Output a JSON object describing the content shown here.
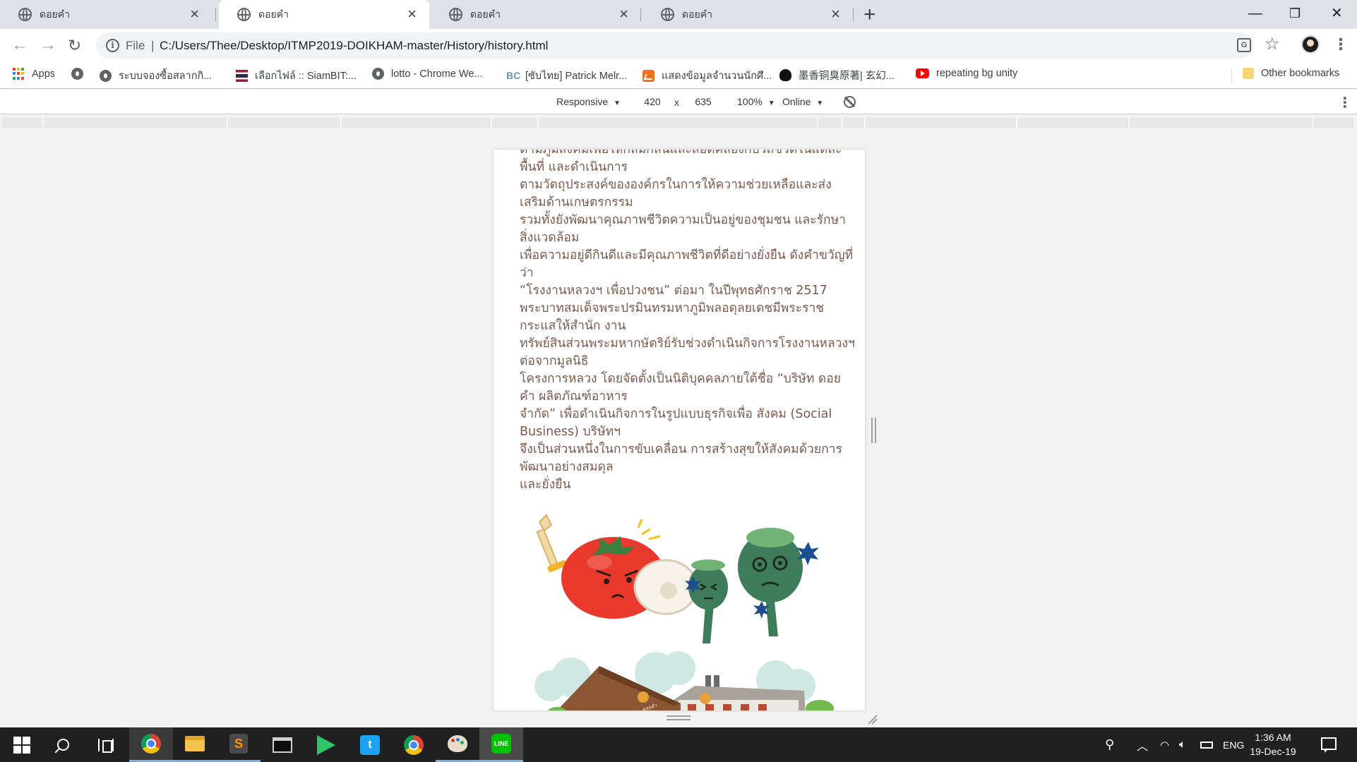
{
  "browser": {
    "tabs": [
      {
        "title": "ดอยคำ",
        "active": false
      },
      {
        "title": "ดอยคำ",
        "active": true
      },
      {
        "title": "ดอยคำ",
        "active": false
      },
      {
        "title": "ดอยคำ",
        "active": false
      }
    ],
    "new_tab_glyph": "+",
    "window_controls": {
      "minimize": "—",
      "restore": "❐",
      "close": "✕"
    },
    "address": {
      "scheme_label": "File",
      "separator": "|",
      "url": "C:/Users/Thee/Desktop/ITMP2019-DOIKHAM-master/History/history.html"
    },
    "icons": [
      "back-arrow-icon",
      "forward-arrow-icon",
      "reload-icon",
      "info-icon",
      "translate-icon",
      "star-icon",
      "profile-avatar",
      "more-vert-icon"
    ]
  },
  "bookmarks": {
    "items": [
      {
        "label": "Apps",
        "icon": "apps-grid-icon"
      },
      {
        "label": "",
        "icon": "globe-icon"
      },
      {
        "label": "ระบบจองซื้อสลากกิ...",
        "icon": "globe-icon"
      },
      {
        "label": "เลือกไฟล์ :: SiamBIT:...",
        "icon": "thai-flag-icon"
      },
      {
        "label": "lotto - Chrome We...",
        "icon": "globe-icon"
      },
      {
        "label": "[ซับไทย] Patrick Melr...",
        "icon": "bc-icon"
      },
      {
        "label": "แสดงข้อมูลจำนวนนักศึ...",
        "icon": "chart-icon"
      },
      {
        "label": "墨香铜臭原著| 玄幻...",
        "icon": "cat-icon"
      },
      {
        "label": "repeating bg unity",
        "icon": "youtube-icon"
      }
    ],
    "other": {
      "label": "Other bookmarks",
      "icon": "folder-icon"
    }
  },
  "device_toolbar": {
    "device": "Responsive",
    "width": "420",
    "times": "x",
    "height": "635",
    "zoom": "100%",
    "throttle": "Online",
    "caret": "▼"
  },
  "page": {
    "paragraph_lines": [
      "ตามภูมิสังคมเพื่อให้กลมกลืนและสอดคล้องกับวิถีชีวิตในแต่ละพื้นที่ และดำเนินการ",
      "ตามวัตถุประสงค์ขององค์กรในการให้ความช่วยเหลือและส่งเสริมด้านเกษตรกรรม",
      "รวมทั้งยังพัฒนาคุณภาพชีวิตความเป็นอยู่ของชุมชน และรักษาสิ่งแวดล้อม",
      "เพื่อความอยู่ดีกินดีและมีคุณภาพชีวิตที่ดีอย่างยั่งยืน ดังคำขวัญที่ว่า",
      "“โรงงานหลวงฯ เพื่อปวงชน” ต่อมา ในปีพุทธศักราช 2517",
      "พระบาทสมเด็จพระปรมินทรมหาภูมิพลอดุลยเดชมีพระราชกระแสให้สำนัก งาน",
      "ทรัพย์สินส่วนพระมหากษัตริย์รับช่วงดำเนินกิจการโรงงานหลวงฯ ต่อจากมูลนิธิ",
      "โครงการหลวง โดยจัดตั้งเป็นนิติบุคคลภายใต้ชื่อ “บริษัท ดอยคำ ผลิตภัณฑ์อาหาร",
      "จำกัด” เพื่อดำเนินกิจการในรูปแบบธุรกิจเพื่อ สังคม (Social Business) บริษัทฯ",
      "จึงเป็นส่วนหนึ่งในการขับเคลื่อน การสร้างสุขให้สังคมด้วยการพัฒนาอย่างสมดุล",
      "และยั่งยืน"
    ],
    "illustration_text": "ดอยคำ"
  },
  "taskbar": {
    "apps": [
      "windows-start-icon",
      "search-icon",
      "task-view-icon",
      "chrome-icon",
      "file-explorer-icon",
      "sublime-text-icon",
      "terminal-icon",
      "media-player-icon",
      "twitter-icon",
      "chrome-icon",
      "paint-icon",
      "line-icon"
    ],
    "tray": {
      "language": "ENG",
      "time": "1:36 AM",
      "date": "19-Dec-19"
    }
  },
  "colors": {
    "tab_strip": "#dee1e6",
    "story_text": "#7a5a4c",
    "taskbar": "#202020",
    "tomato": "#e8392c",
    "poppy": "#3f7d5a"
  }
}
